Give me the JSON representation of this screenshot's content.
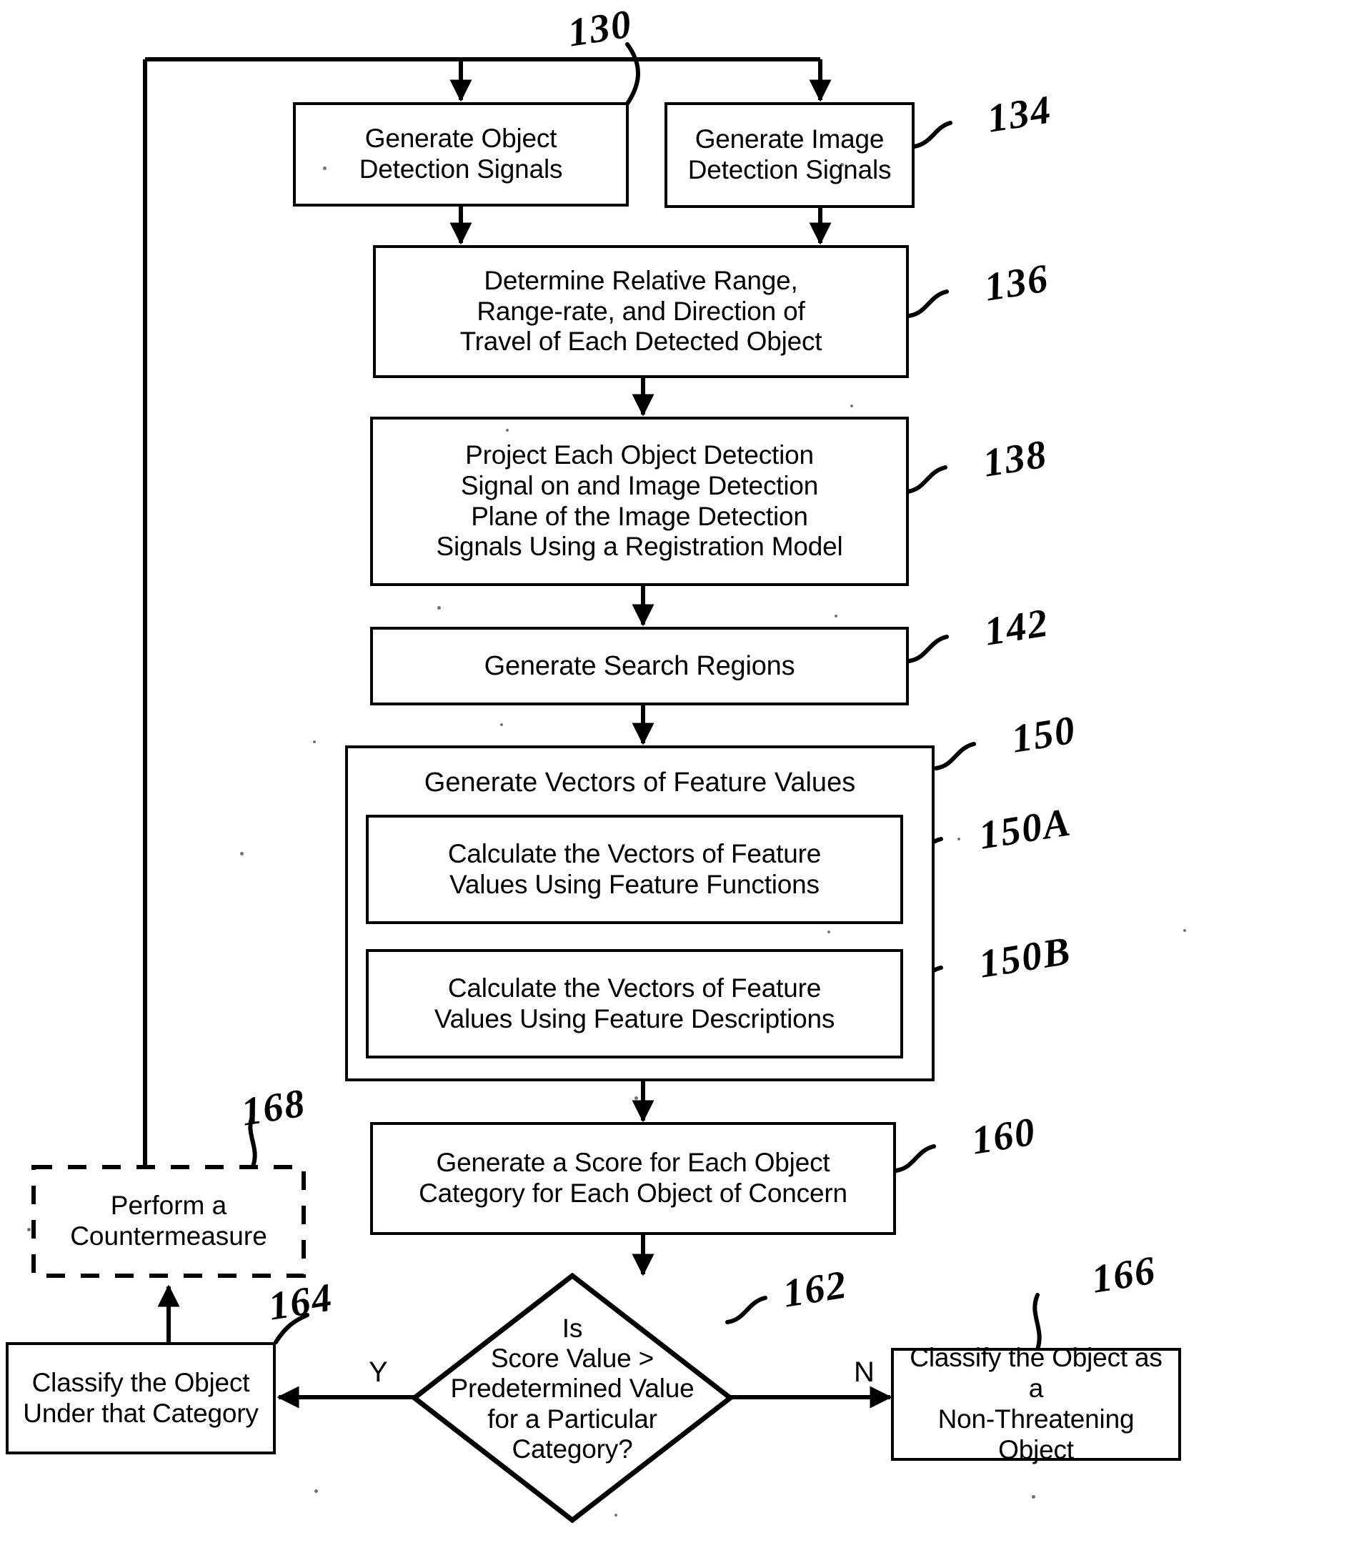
{
  "diagram": {
    "type": "flowchart",
    "title_numeral": "130",
    "nodes": [
      {
        "id": "n130",
        "ref": "130",
        "label": "Generate Object\nDetection Signals",
        "shape": "process"
      },
      {
        "id": "n134",
        "ref": "134",
        "label": "Generate Image\nDetection Signals",
        "shape": "process"
      },
      {
        "id": "n136",
        "ref": "136",
        "label": "Determine Relative Range,\nRange-rate, and Direction of\nTravel of Each Detected Object",
        "shape": "process"
      },
      {
        "id": "n138",
        "ref": "138",
        "label": "Project Each Object Detection\nSignal on and Image Detection\nPlane of the Image Detection\nSignals Using a Registration Model",
        "shape": "process"
      },
      {
        "id": "n142",
        "ref": "142",
        "label": "Generate Search Regions",
        "shape": "process"
      },
      {
        "id": "n150",
        "ref": "150",
        "label": "Generate Vectors of Feature Values",
        "shape": "group"
      },
      {
        "id": "n150A",
        "ref": "150A",
        "label": "Calculate the Vectors of Feature\nValues Using Feature Functions",
        "shape": "process"
      },
      {
        "id": "n150B",
        "ref": "150B",
        "label": "Calculate the Vectors of Feature\nValues Using Feature Descriptions",
        "shape": "process"
      },
      {
        "id": "n160",
        "ref": "160",
        "label": "Generate a Score for Each Object\nCategory for Each Object of Concern",
        "shape": "process"
      },
      {
        "id": "n162",
        "ref": "162",
        "label": "Is\nScore Value >\nPredetermined Value\nfor a Particular\nCategory?",
        "shape": "decision"
      },
      {
        "id": "n164",
        "ref": "164",
        "label": "Classify the Object\nUnder that Category",
        "shape": "process"
      },
      {
        "id": "n166",
        "ref": "166",
        "label": "Classify the Object as a\nNon-Threatening Object",
        "shape": "process"
      },
      {
        "id": "n168",
        "ref": "168",
        "label": "Perform a\nCountermeasure",
        "shape": "process-optional-dashed"
      }
    ],
    "branch_labels": {
      "yes": "Y",
      "no": "N"
    },
    "colors": {
      "stroke": "#000000",
      "fill": "#ffffff"
    }
  }
}
